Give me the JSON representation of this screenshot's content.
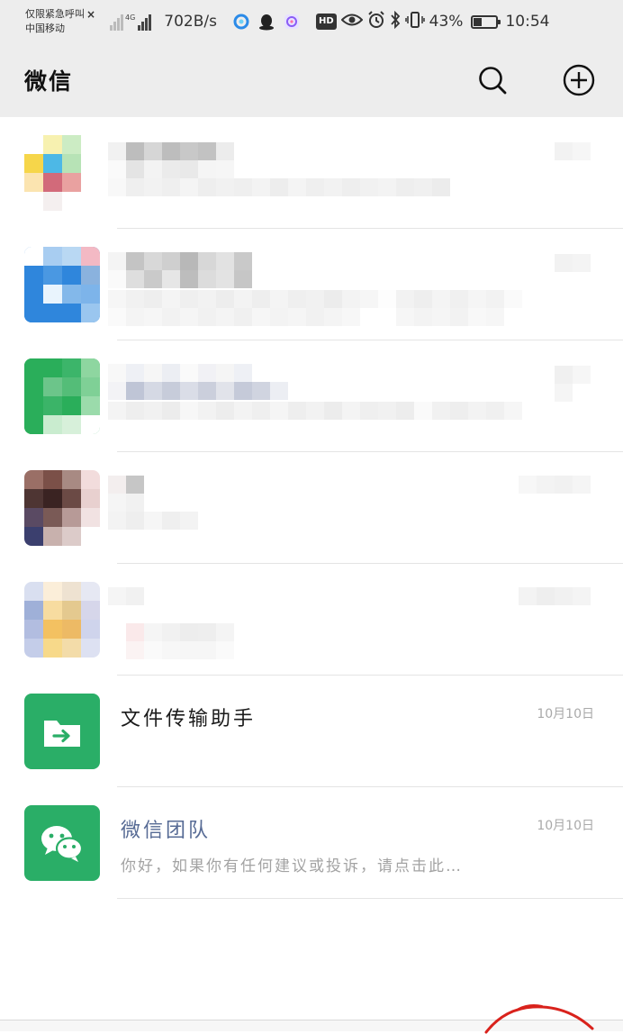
{
  "status_bar": {
    "carrier_line1": "仅限紧急呼叫",
    "carrier_line2": "中国移动",
    "network_tag": "4G",
    "speed": "702B/s",
    "hd_badge": "HD",
    "battery_percent": 43,
    "battery_text": "43%",
    "time": "10:54"
  },
  "header": {
    "title": "微信"
  },
  "chats": [
    {
      "name": "",
      "preview": "",
      "time": "",
      "obscured": true
    },
    {
      "name": "",
      "preview": "",
      "time": "",
      "obscured": true
    },
    {
      "name": "",
      "preview": "",
      "time": "",
      "obscured": true
    },
    {
      "name": "",
      "preview": "",
      "time": "",
      "obscured": true
    },
    {
      "name": "",
      "preview": "",
      "time": "",
      "obscured": true
    },
    {
      "name": "文件传输助手",
      "preview": "",
      "time": "10月10日",
      "avatar_icon": "folder-transfer-icon",
      "avatar_color": "#2aae67"
    },
    {
      "name": "微信团队",
      "preview": "你好，如果你有任何建议或投诉，请点击此…",
      "time": "10月10日",
      "avatar_icon": "wechat-logo-icon",
      "avatar_color": "#2aae67",
      "official": true
    }
  ],
  "colors": {
    "header_bg": "#ededed",
    "wechat_green": "#2aae67",
    "official_name": "#576b95",
    "annotation_red": "#d9221c"
  }
}
